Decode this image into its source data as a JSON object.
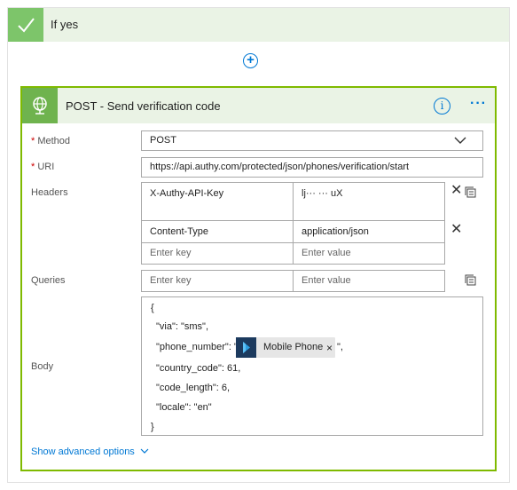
{
  "condition": {
    "label": "If yes"
  },
  "action": {
    "title": "POST - Send verification code",
    "method": {
      "label": "Method",
      "value": "POST"
    },
    "uri": {
      "label": "URI",
      "value": "https://api.authy.com/protected/json/phones/verification/start"
    },
    "headers": {
      "label": "Headers",
      "rows": [
        {
          "key": "X-Authy-API-Key",
          "value": "lj··· ···        uX"
        },
        {
          "key": "Content-Type",
          "value": "application/json"
        }
      ],
      "key_placeholder": "Enter key",
      "value_placeholder": "Enter value"
    },
    "queries": {
      "label": "Queries",
      "key_placeholder": "Enter key",
      "value_placeholder": "Enter value"
    },
    "body": {
      "label": "Body",
      "lines": [
        "{",
        "\"via\": \"sms\",",
        "\"phone_number\": \"",
        "\"country_code\": 61,",
        "\"code_length\": 6,",
        "\"locale\": \"en\"",
        "}"
      ],
      "token_label": "Mobile Phone",
      "token_suffix": "\","
    },
    "advanced_label": "Show advanced options"
  },
  "icons": [
    "check-icon",
    "plus-circle-icon",
    "globe-icon",
    "info-icon",
    "more-icon",
    "chevron-down-icon",
    "close-icon",
    "bulk-edit-icon",
    "dynamics-icon"
  ],
  "colors": {
    "accent": "#0078d4",
    "success": "#7fba00",
    "header_bg": "#eaf3e5"
  }
}
